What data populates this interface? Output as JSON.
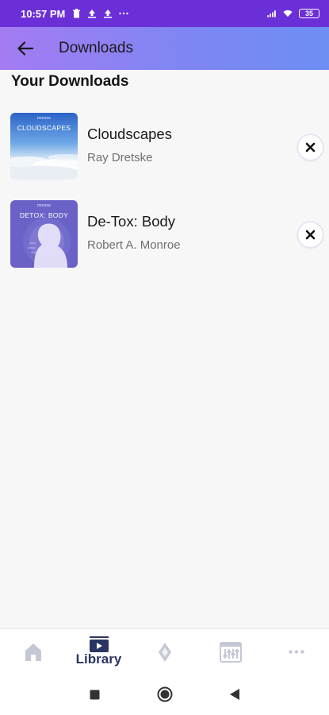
{
  "status_bar": {
    "time": "10:57 PM",
    "battery": "35",
    "left_icons": [
      "trash-icon",
      "upload-icon",
      "upload-icon",
      "more-dots-icon"
    ],
    "right_icons": [
      "signal-icon",
      "wifi-icon",
      "battery-icon"
    ]
  },
  "header": {
    "title": "Downloads",
    "back_icon": "arrow-left-icon"
  },
  "section_title": "Your Downloads",
  "downloads": [
    {
      "title": "Cloudscapes",
      "author": "Ray Dretske",
      "cover_text": "CLOUDSCAPES",
      "cover_brand": "monroe",
      "cover_colors": [
        "#3a74d6",
        "#cfe2f5"
      ],
      "remove_icon": "close-icon"
    },
    {
      "title": "De-Tox: Body",
      "author": "Robert A. Monroe",
      "cover_text": "DETOX: BODY",
      "cover_brand": "monroe",
      "cover_colors": [
        "#6b63c8",
        "#5b54b8"
      ],
      "remove_icon": "close-icon"
    }
  ],
  "bottom_nav": {
    "active": "Library",
    "items": [
      {
        "icon": "home-icon",
        "label": ""
      },
      {
        "icon": "library-icon",
        "label": "Library"
      },
      {
        "icon": "diamond-icon",
        "label": ""
      },
      {
        "icon": "equalizer-icon",
        "label": ""
      },
      {
        "icon": "more-icon",
        "label": ""
      }
    ],
    "accent": "#2a3563",
    "inactive": "#c4c8d4"
  },
  "system_nav": {
    "icons": [
      "recent-apps-icon",
      "home-circle-icon",
      "back-triangle-icon"
    ]
  },
  "colors": {
    "status_bar": "#6a2fd6",
    "header_gradient": [
      "#a57bf2",
      "#6d8ef5"
    ],
    "background": "#f7f7f8"
  }
}
